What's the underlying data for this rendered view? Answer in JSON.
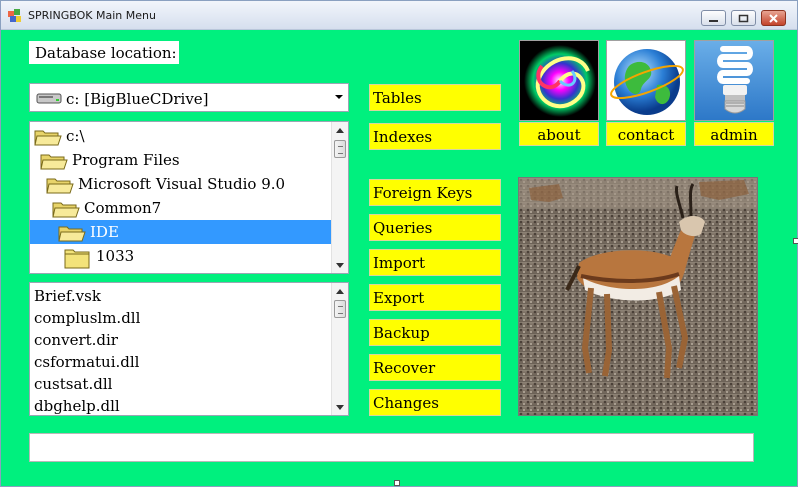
{
  "window": {
    "title": "SPRINGBOK Main Menu"
  },
  "controls": {
    "minimize_icon": "minimize-icon",
    "maximize_icon": "maximize-icon",
    "close_icon": "close-icon"
  },
  "database": {
    "label": "Database location:",
    "drive": "c: [BigBlueCDrive]"
  },
  "directories": [
    {
      "label": "c:\\",
      "selected": false
    },
    {
      "label": "Program Files",
      "selected": false
    },
    {
      "label": "Microsoft Visual Studio 9.0",
      "selected": false
    },
    {
      "label": "Common7",
      "selected": false
    },
    {
      "label": "IDE",
      "selected": true
    },
    {
      "label": "1033",
      "selected": false
    }
  ],
  "files": [
    "Brief.vsk",
    "compluslm.dll",
    "convert.dir",
    "csformatui.dll",
    "custsat.dll",
    "dbghelp.dll"
  ],
  "menu_buttons": {
    "tables": "Tables",
    "indexes": "Indexes",
    "foreign_keys": "Foreign Keys",
    "queries": "Queries",
    "import": "Import",
    "export": "Export",
    "backup": "Backup",
    "recover": "Recover",
    "changes": "Changes"
  },
  "tiles": {
    "about": "about",
    "contact": "contact",
    "admin": "admin"
  },
  "status": {
    "text": ""
  },
  "colors": {
    "background": "#00f07e",
    "button": "#ffff00",
    "selection": "#3399ff"
  }
}
